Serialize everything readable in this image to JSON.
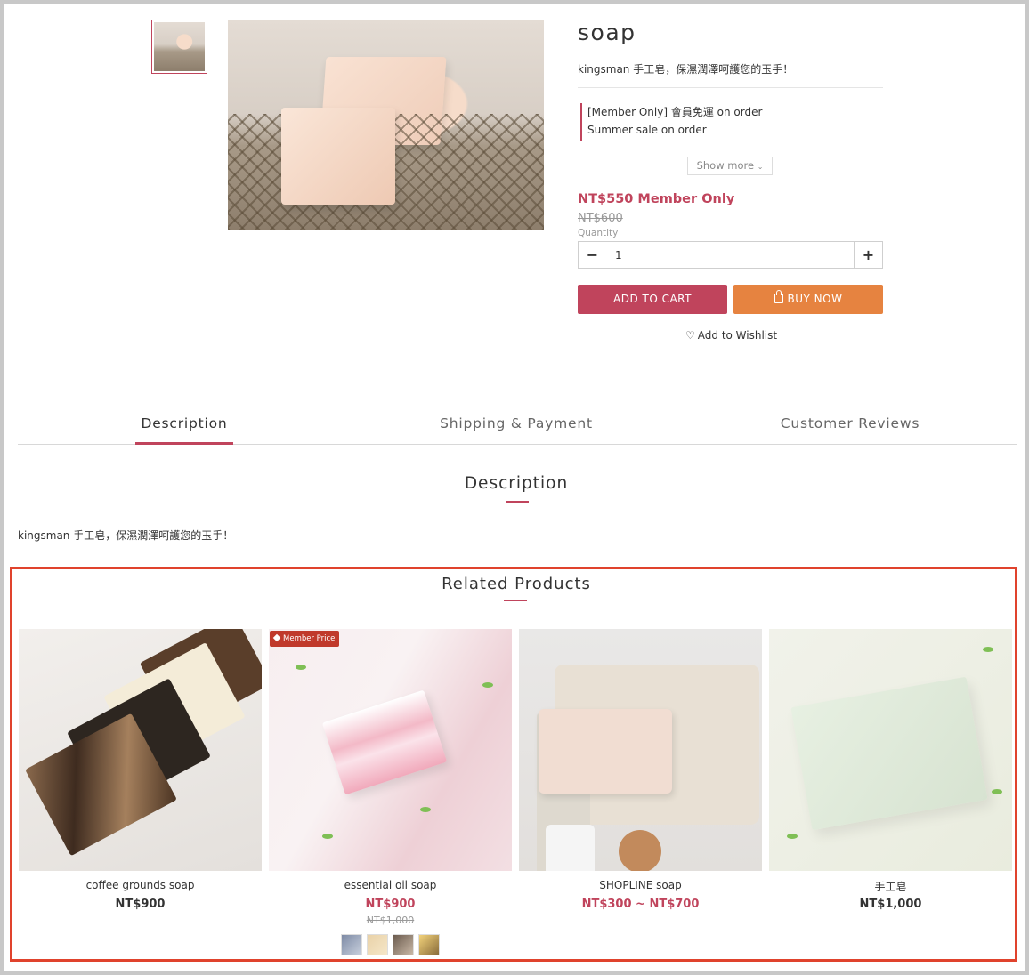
{
  "product": {
    "title": "soap",
    "subtitle": "kingsman 手工皂，保濕潤澤呵護您的玉手！",
    "promotions": [
      "[Member Only] 會員免運 on order",
      "Summer sale on order"
    ],
    "show_more_label": "Show more",
    "member_price": "NT$550 Member Only",
    "original_price": "NT$600",
    "quantity_label": "Quantity",
    "quantity_value": "1",
    "add_to_cart_label": "ADD TO CART",
    "buy_now_label": "BUY NOW",
    "wishlist_label": "Add to Wishlist"
  },
  "tabs": [
    {
      "label": "Description",
      "active": true
    },
    {
      "label": "Shipping & Payment",
      "active": false
    },
    {
      "label": "Customer Reviews",
      "active": false
    }
  ],
  "description": {
    "heading": "Description",
    "text": "kingsman 手工皂，保濕潤澤呵護您的玉手！"
  },
  "related": {
    "heading": "Related Products",
    "badge": "Member Price",
    "items": [
      {
        "name": "coffee grounds soap",
        "price": "NT$900",
        "old_price": ""
      },
      {
        "name": "essential oil soap",
        "price": "NT$900",
        "old_price": "NT$1,000"
      },
      {
        "name": "SHOPLINE soap",
        "price": "NT$300 ~ NT$700",
        "old_price": ""
      },
      {
        "name": "手工皂",
        "price": "NT$1,000",
        "old_price": ""
      }
    ]
  },
  "colors": {
    "accent": "#c0445c",
    "buy_now": "#e68340",
    "highlight_box": "#e0432d"
  }
}
